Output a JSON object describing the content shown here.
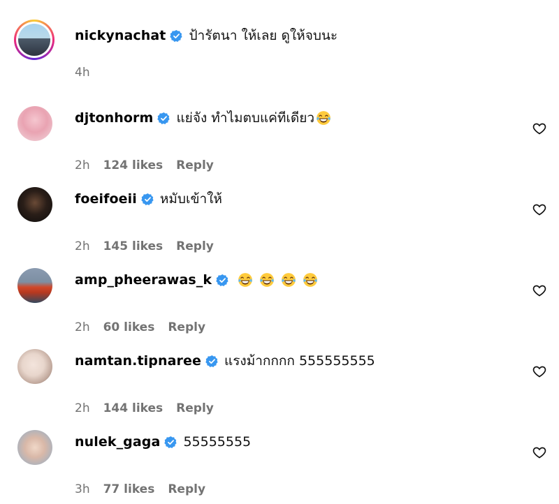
{
  "reply_label": "Reply",
  "comments": [
    {
      "username": "nickynachat",
      "verified": true,
      "text": "ป้ารัตนา ให้เลย ดูให้จบนะ",
      "emoji_count": 0,
      "time": "4h",
      "likes": "",
      "show_heart": false,
      "avatar_icon": "avatar-story-ring"
    },
    {
      "username": "djtonhorm",
      "verified": true,
      "text": "แย่จัง ทำไมตบแค่ทีเดียว",
      "emoji_count": 1,
      "time": "2h",
      "likes": "124 likes",
      "show_heart": true,
      "avatar_icon": "avatar"
    },
    {
      "username": "foeifoeii",
      "verified": true,
      "text": "หมับเข้าให้",
      "emoji_count": 0,
      "time": "2h",
      "likes": "145 likes",
      "show_heart": true,
      "avatar_icon": "avatar"
    },
    {
      "username": "amp_pheerawas_k",
      "verified": true,
      "text": "",
      "emoji_count": 4,
      "time": "2h",
      "likes": "60 likes",
      "show_heart": true,
      "avatar_icon": "avatar"
    },
    {
      "username": "namtan.tipnaree",
      "verified": true,
      "text": "แรงม้ากกกก 555555555",
      "emoji_count": 0,
      "time": "2h",
      "likes": "144 likes",
      "show_heart": true,
      "avatar_icon": "avatar"
    },
    {
      "username": "nulek_gaga",
      "verified": true,
      "text": "55555555",
      "emoji_count": 0,
      "time": "3h",
      "likes": "77 likes",
      "show_heart": true,
      "avatar_icon": "avatar"
    }
  ],
  "colors": {
    "verified_badge": "#3897f0",
    "meta_text": "#737373",
    "emoji_face": "#ffcb3d"
  }
}
